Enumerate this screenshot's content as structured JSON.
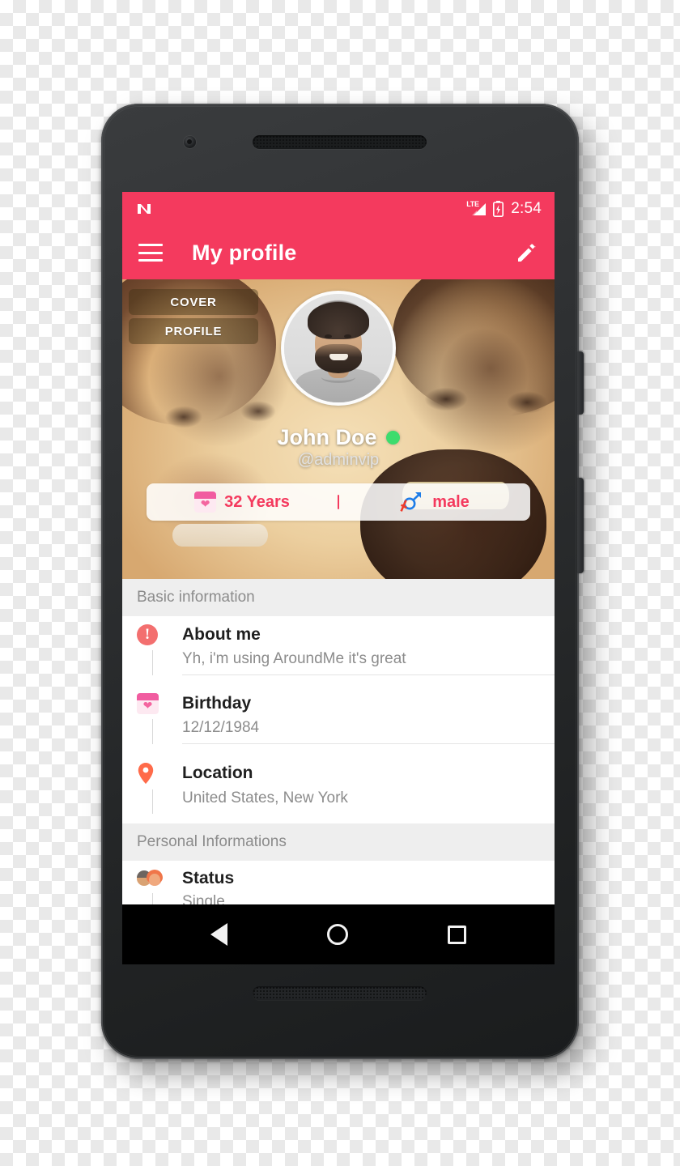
{
  "status_bar": {
    "os_logo": "android-nougat-logo",
    "network_label": "LTE",
    "signal_icon": "signal-bars-icon",
    "battery_icon": "battery-charging-icon",
    "time": "2:54"
  },
  "app_bar": {
    "menu_icon": "hamburger-menu-icon",
    "title": "My profile",
    "edit_icon": "pencil-edit-icon"
  },
  "hero": {
    "tabs": [
      {
        "label": "COVER",
        "name": "cover-tab"
      },
      {
        "label": "PROFILE",
        "name": "profile-tab"
      }
    ],
    "avatar_alt": "profile-avatar",
    "display_name": "John Doe",
    "online_status": "online",
    "username": "@adminvip",
    "meta": {
      "age_icon": "calendar-heart-icon",
      "age": "32 Years",
      "separator": "|",
      "gender_icon": "gender-symbols-icon",
      "gender": "male"
    }
  },
  "sections": [
    {
      "title": "Basic information",
      "rows": [
        {
          "icon": "alert-circle-icon",
          "label": "About me",
          "value": "Yh, i'm using AroundMe it's great"
        },
        {
          "icon": "calendar-heart-icon",
          "label": "Birthday",
          "value": "12/12/1984"
        },
        {
          "icon": "location-pin-icon",
          "label": "Location",
          "value": "United States, New York"
        }
      ]
    },
    {
      "title": "Personal Informations",
      "rows": [
        {
          "icon": "couple-icon",
          "label": "Status",
          "value": "Single"
        }
      ]
    }
  ],
  "nav_bar": {
    "back": "back-triangle-icon",
    "home": "home-circle-icon",
    "recents": "recents-square-icon"
  },
  "colors": {
    "accent": "#f43a5e",
    "online": "#3ddc6d",
    "alert": "#f36f6f",
    "pin": "#ff6b4a",
    "section_bg": "#eeeeee",
    "muted_text": "#8c8c8c"
  }
}
